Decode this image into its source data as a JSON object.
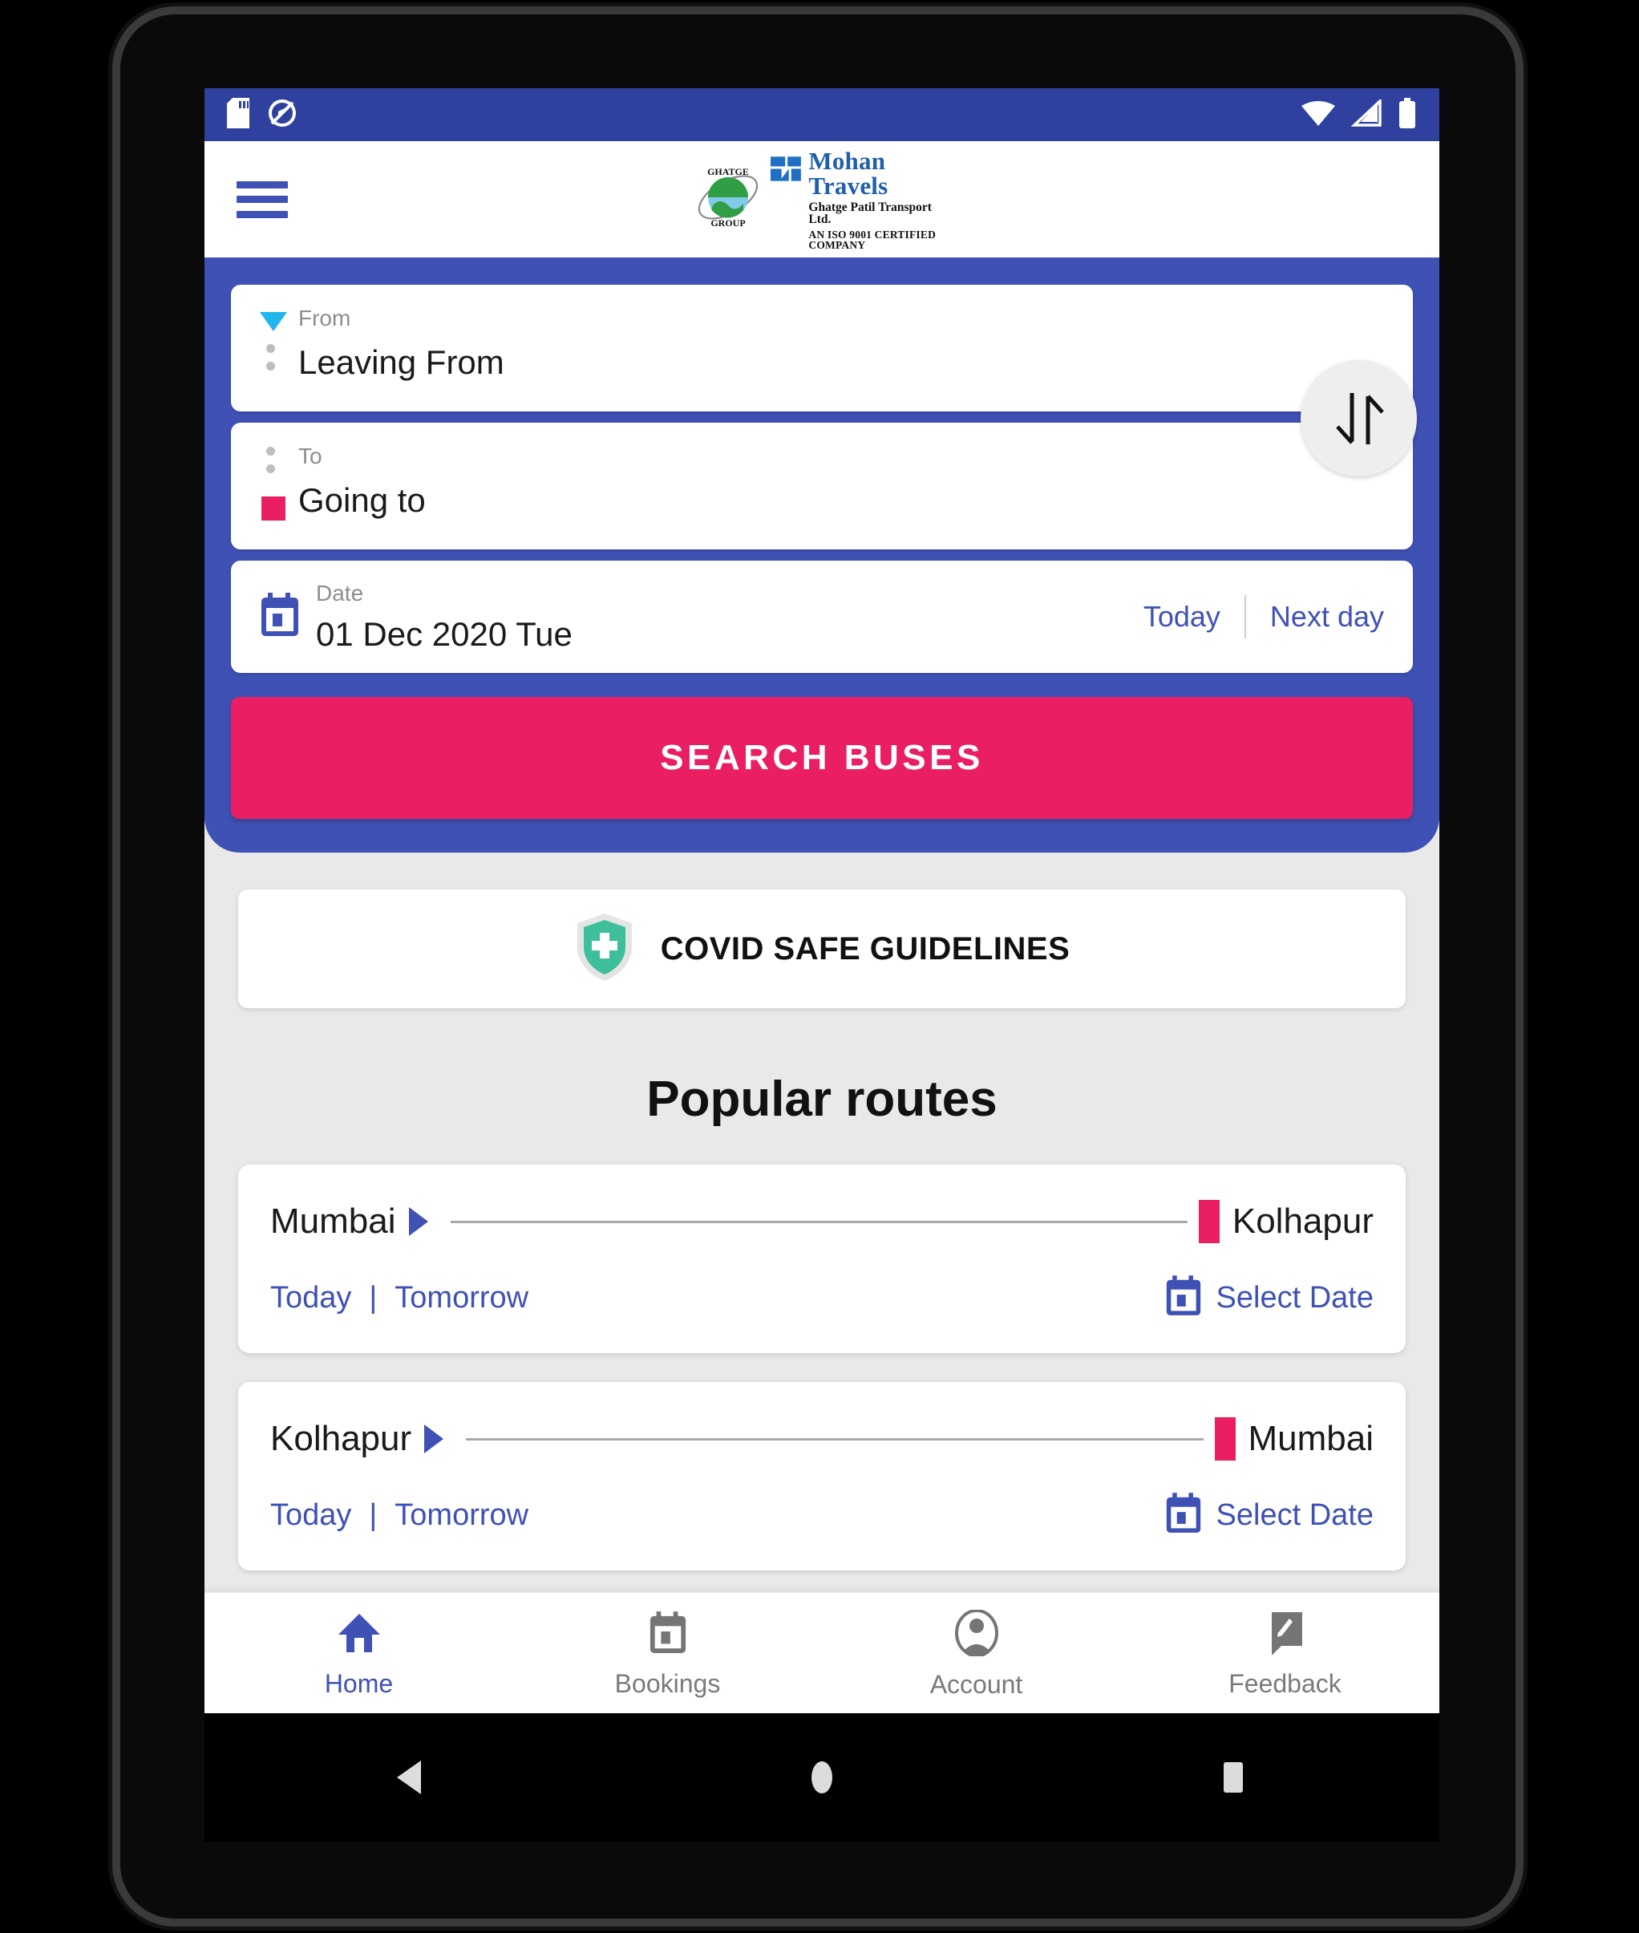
{
  "status_bar": {
    "left_icons": [
      "sd-card-icon",
      "no-location-icon"
    ],
    "right_icons": [
      "wifi-icon",
      "signal-icon",
      "battery-icon"
    ],
    "background": "#2f409e"
  },
  "app_bar": {
    "menu_icon": "hamburger-menu-icon",
    "logo": {
      "mark": "ghatge-group-globe-logo",
      "mark_text_top": "GHATGE",
      "mark_text_bottom": "GROUP",
      "line1": "Mohan Travels",
      "line2": "Ghatge Patil Transport Ltd.",
      "line3": "AN ISO 9001 CERTIFIED COMPANY"
    }
  },
  "search_panel": {
    "from": {
      "label": "From",
      "value": "Leaving From",
      "marker_icon": "triangle-down-marker-icon"
    },
    "to": {
      "label": "To",
      "value": "Going to",
      "marker_icon": "pink-square-marker-icon"
    },
    "swap_icon": "swap-vertical-icon",
    "date": {
      "label": "Date",
      "value": "01 Dec 2020 Tue",
      "calendar_icon": "calendar-icon",
      "today_label": "Today",
      "next_day_label": "Next day"
    },
    "search_button_label": "SEARCH BUSES",
    "accent": "#3f51b5",
    "cta_color": "#e91e63"
  },
  "covid": {
    "icon": "shield-plus-icon",
    "label": "COVID SAFE GUIDELINES",
    "icon_color": "#3dbf9b"
  },
  "popular": {
    "title": "Popular routes",
    "routes": [
      {
        "origin": "Mumbai",
        "destination": "Kolhapur",
        "today_label": "Today",
        "separator": "|",
        "tomorrow_label": "Tomorrow",
        "select_date_label": "Select Date",
        "calendar_icon": "calendar-icon"
      },
      {
        "origin": "Kolhapur",
        "destination": "Mumbai",
        "today_label": "Today",
        "separator": "|",
        "tomorrow_label": "Tomorrow",
        "select_date_label": "Select Date",
        "calendar_icon": "calendar-icon"
      }
    ]
  },
  "bottom_nav": {
    "items": [
      {
        "label": "Home",
        "icon": "home-icon",
        "active": true
      },
      {
        "label": "Bookings",
        "icon": "bookings-ticket-icon",
        "active": false
      },
      {
        "label": "Account",
        "icon": "account-person-icon",
        "active": false
      },
      {
        "label": "Feedback",
        "icon": "feedback-edit-icon",
        "active": false
      }
    ]
  },
  "android_nav": {
    "back_icon": "back-triangle-icon",
    "home_icon": "home-circle-icon",
    "recents_icon": "recents-square-icon"
  }
}
